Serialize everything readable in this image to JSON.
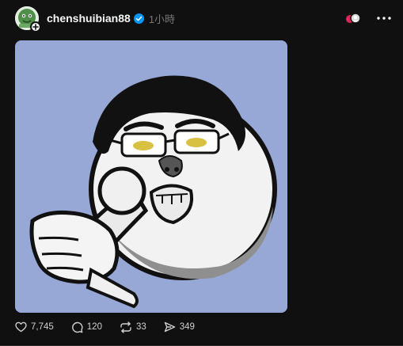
{
  "post": {
    "username": "chenshuibian88",
    "timestamp": "1小時",
    "icons": {
      "avatar": "cartoon-avatar-icon",
      "follow": "plus-icon",
      "verified": "verified-badge-icon",
      "reaction": "reaction-avatars-icon",
      "more": "more-horizontal-icon"
    },
    "image": "cartoon-pointing-man-illustration",
    "stats": {
      "likes": "7,745",
      "comments": "120",
      "reposts": "33",
      "shares": "349"
    }
  },
  "colors": {
    "background": "#101010",
    "verified_blue": "#0095f6",
    "image_background": "#98a8d6",
    "text_muted": "#777777"
  }
}
